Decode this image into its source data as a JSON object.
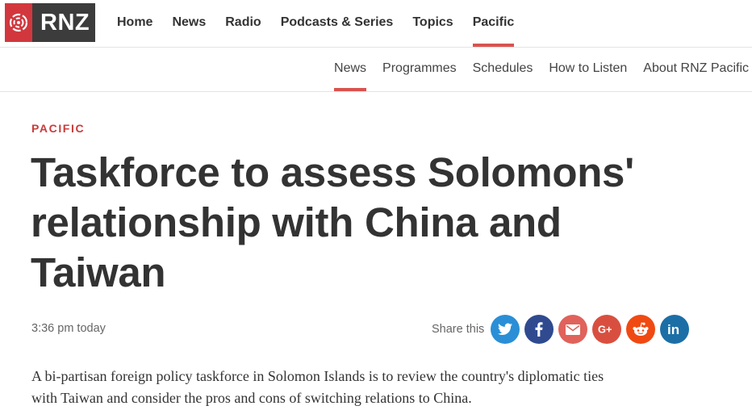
{
  "brand": {
    "logo_text": "RNZ"
  },
  "main_nav": [
    "Home",
    "News",
    "Radio",
    "Podcasts & Series",
    "Topics",
    "Pacific"
  ],
  "main_nav_active": "Pacific",
  "sub_nav": [
    "News",
    "Programmes",
    "Schedules",
    "How to Listen",
    "About RNZ Pacific"
  ],
  "sub_nav_active": "News",
  "article": {
    "section": "PACIFIC",
    "headline_lines": [
      "Taskforce to assess Solomons'",
      "relationship with China and",
      "Taiwan"
    ],
    "time": "3:36 pm today",
    "share_label": "Share this",
    "lead_lines": [
      "A bi-partisan foreign policy taskforce in Solomon Islands is to review the country's diplomatic ties",
      "with Taiwan and consider the pros and cons of switching relations to China."
    ]
  },
  "share_buttons": [
    {
      "name": "twitter",
      "color": "#2a8fd6"
    },
    {
      "name": "facebook",
      "color": "#2f4a8f"
    },
    {
      "name": "email",
      "color": "#e0625b"
    },
    {
      "name": "google-plus",
      "color": "#d94f3f"
    },
    {
      "name": "reddit",
      "color": "#f04a12"
    },
    {
      "name": "linkedin",
      "color": "#1b6fa6"
    }
  ],
  "colors": {
    "accent": "#d9534f",
    "logo_bg": "#3c3c3c",
    "logo_mark": "#d2373e"
  }
}
